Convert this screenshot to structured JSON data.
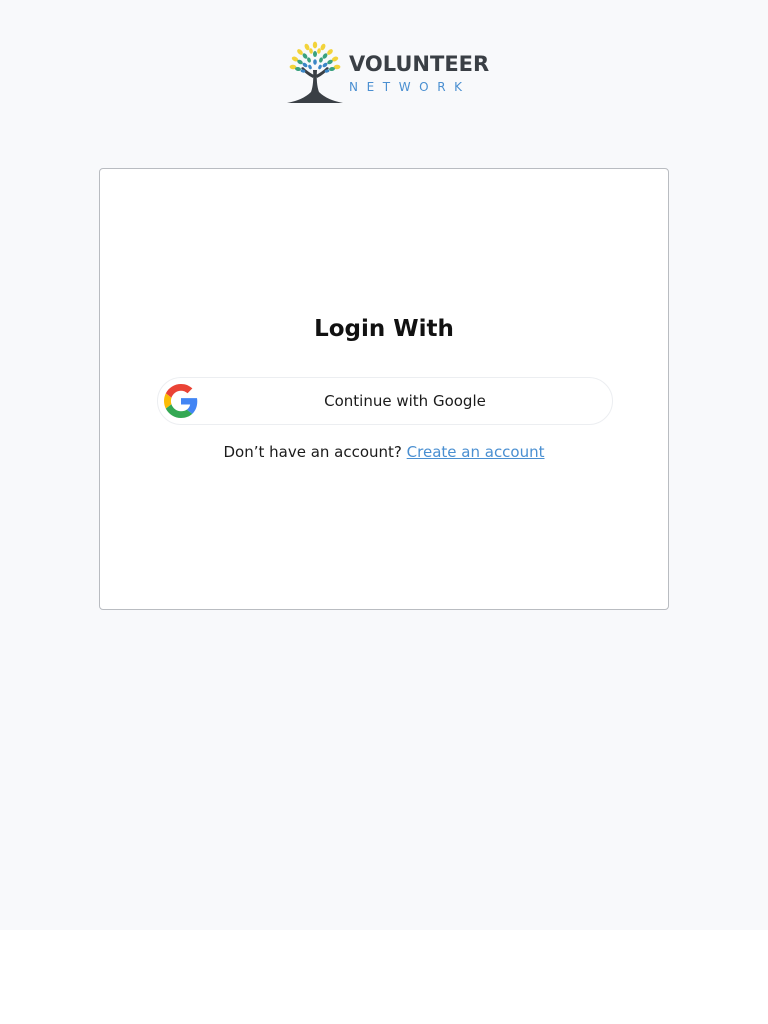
{
  "brand": {
    "name": "VOLUNTEER",
    "subtitle": "NETWORK",
    "logo_icon": "tree-logo-icon",
    "colors": {
      "wordmark": "#3a3f45",
      "subtitle": "#4a8fd1",
      "leaf_yellow": "#f2d33a",
      "leaf_green": "#3aa17e",
      "leaf_blue": "#3b86c6",
      "trunk": "#3a3f45"
    }
  },
  "login": {
    "title": "Login With",
    "google_button_label": "Continue with Google",
    "google_icon": "google-icon",
    "signup_prompt": "Don’t have an account?",
    "signup_link": "Create an account"
  },
  "colors": {
    "page_background": "#f8f9fb",
    "card_background": "#ffffff",
    "card_border": "#b9bcc1",
    "link": "#4a8fd1",
    "text": "#1b1b1b"
  }
}
